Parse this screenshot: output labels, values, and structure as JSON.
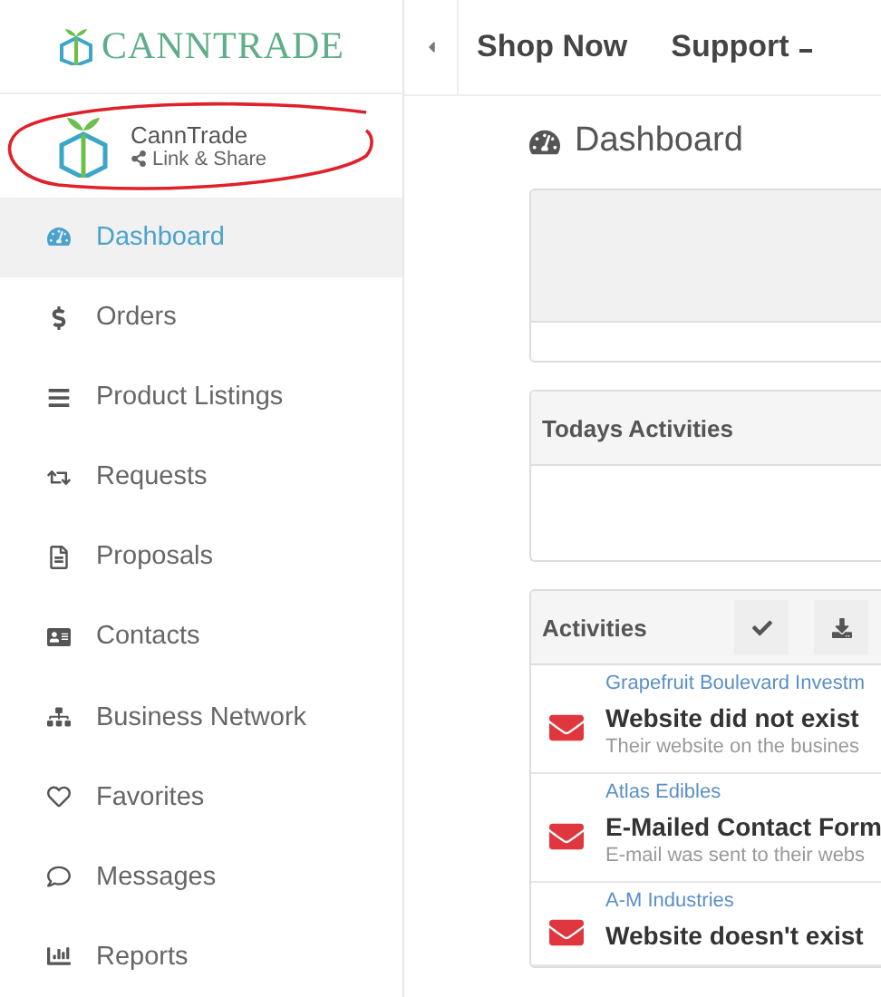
{
  "logo": {
    "text": "CANNTRADE"
  },
  "profile": {
    "name": "CannTrade",
    "link": "Link & Share"
  },
  "sidebar": {
    "items": [
      {
        "label": "Dashboard",
        "selected": true
      },
      {
        "label": "Orders",
        "selected": false
      },
      {
        "label": "Product Listings",
        "selected": false
      },
      {
        "label": "Requests",
        "selected": false
      },
      {
        "label": "Proposals",
        "selected": false
      },
      {
        "label": "Contacts",
        "selected": false
      },
      {
        "label": "Business Network",
        "selected": false
      },
      {
        "label": "Favorites",
        "selected": false
      },
      {
        "label": "Messages",
        "selected": false
      },
      {
        "label": "Reports",
        "selected": false
      }
    ]
  },
  "topbar": {
    "items": [
      {
        "label": "Shop Now",
        "kind": "link"
      },
      {
        "label": "Support",
        "kind": "dropdown"
      }
    ]
  },
  "page_title": "Dashboard",
  "todays_panel": {
    "title": "Todays Activities"
  },
  "activities": {
    "title": "Activities",
    "items": [
      {
        "company": "Grapefruit Boulevard Investm",
        "title": "Website did not exist",
        "description": "Their website on the busines"
      },
      {
        "company": "Atlas Edibles",
        "title": "E-Mailed Contact Form",
        "description": "E-mail was sent to their webs"
      },
      {
        "company": "A-M Industries",
        "title": "Website doesn't exist"
      }
    ]
  }
}
